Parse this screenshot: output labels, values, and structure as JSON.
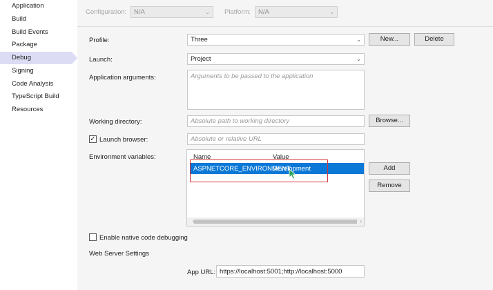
{
  "sidebar": {
    "items": [
      {
        "label": "Application"
      },
      {
        "label": "Build"
      },
      {
        "label": "Build Events"
      },
      {
        "label": "Package"
      },
      {
        "label": "Debug"
      },
      {
        "label": "Signing"
      },
      {
        "label": "Code Analysis"
      },
      {
        "label": "TypeScript Build"
      },
      {
        "label": "Resources"
      }
    ],
    "selected": "Debug"
  },
  "config": {
    "configuration_label": "Configuration:",
    "configuration_value": "N/A",
    "platform_label": "Platform:",
    "platform_value": "N/A"
  },
  "profile": {
    "label": "Profile:",
    "value": "Three",
    "new_button": "New...",
    "delete_button": "Delete"
  },
  "launch": {
    "label": "Launch:",
    "value": "Project"
  },
  "app_args": {
    "label": "Application arguments:",
    "placeholder": "Arguments to be passed to the application"
  },
  "working_dir": {
    "label": "Working directory:",
    "placeholder": "Absolute path to working directory",
    "browse_button": "Browse..."
  },
  "launch_browser": {
    "label": "Launch browser:",
    "checked": true,
    "placeholder": "Absolute or relative URL"
  },
  "env": {
    "label": "Environment variables:",
    "columns": [
      "Name",
      "Value"
    ],
    "rows": [
      {
        "name": "ASPNETCORE_ENVIRONMENT",
        "value": "Development"
      }
    ],
    "add_button": "Add",
    "remove_button": "Remove"
  },
  "native_debug": {
    "label": "Enable native code debugging",
    "checked": false
  },
  "web_server": {
    "heading": "Web Server Settings",
    "app_url_label": "App URL:",
    "app_url_value": "https://localhost:5001;http://localhost:5000"
  },
  "icons": {
    "dropdown": "chevron-down-icon",
    "cursor": "mouse-pointer-icon"
  },
  "colors": {
    "selection": "#0a78d7",
    "highlight": "#d0343c",
    "sidebar_selected": "#dcdcf5"
  }
}
